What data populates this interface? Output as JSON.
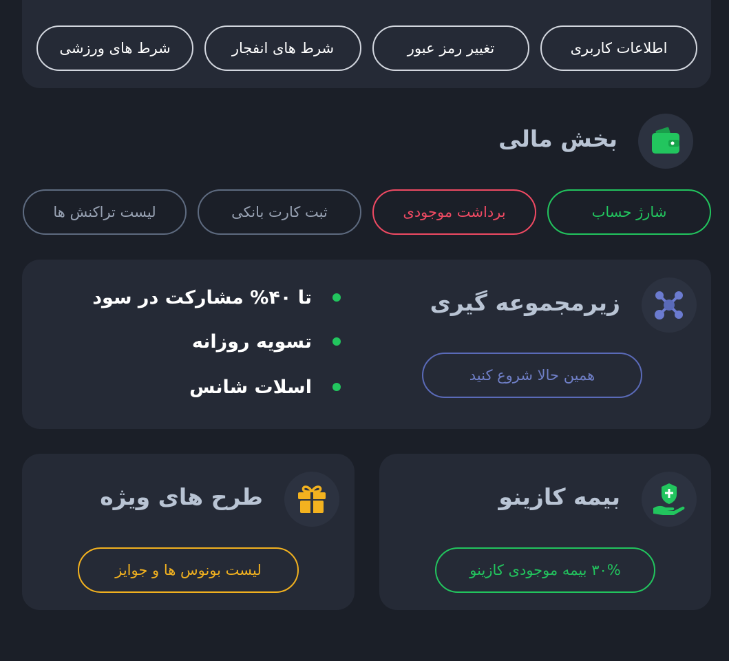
{
  "account_menu": {
    "items": [
      {
        "label": "اطلاعات کاربری"
      },
      {
        "label": "تغییر رمز عبور"
      },
      {
        "label": "شرط های انفجار"
      },
      {
        "label": "شرط های ورزشی"
      }
    ]
  },
  "finance": {
    "title": "بخش مالی",
    "icon": "wallet-icon",
    "buttons": [
      {
        "label": "شارژ حساب",
        "color": "#22c55e"
      },
      {
        "label": "برداشت موجودی",
        "color": "#f04a63"
      },
      {
        "label": "ثبت کارت بانکی",
        "color": "#98a2b3"
      },
      {
        "label": "لیست تراکنش ها",
        "color": "#98a2b3"
      }
    ]
  },
  "referral": {
    "title": "زیرمجموعه گیری",
    "icon": "network-icon",
    "features": [
      "تا ۴۰% مشارکت در سود",
      "تسویه روزانه",
      "اسلات شانس"
    ],
    "cta": "همین حالا شروع کنید"
  },
  "insurance": {
    "title": "بیمه کازینو",
    "icon": "insurance-hand-icon",
    "button": "۳۰% بیمه موجودی کازینو"
  },
  "special": {
    "title": "طرح های ویژه",
    "icon": "gift-icon",
    "button": "لیست بونوس ها و جوایز"
  },
  "colors": {
    "background": "#1b1f28",
    "card": "#252a36",
    "green": "#22c55e",
    "red": "#f04a63",
    "gold": "#f3b21f",
    "blue": "#6f7fc7"
  }
}
